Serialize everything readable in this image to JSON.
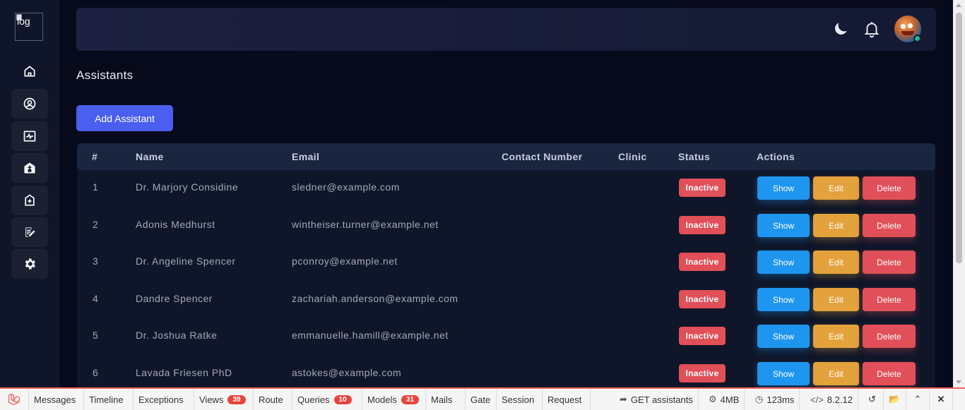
{
  "sidebar": {
    "logo_alt": "log",
    "items": [
      {
        "name": "home",
        "icon": "home-icon"
      },
      {
        "name": "profile",
        "icon": "user-circle-icon"
      },
      {
        "name": "activity",
        "icon": "activity-monitor-icon"
      },
      {
        "name": "clinics",
        "icon": "hospital-icon"
      },
      {
        "name": "medical",
        "icon": "medical-house-icon"
      },
      {
        "name": "records",
        "icon": "clipboard-edit-icon"
      },
      {
        "name": "settings",
        "icon": "gear-icon"
      }
    ]
  },
  "header": {
    "theme_icon": "moon-icon",
    "notification_icon": "bell-icon"
  },
  "page": {
    "title": "Assistants",
    "add_button": "Add Assistant"
  },
  "table": {
    "columns": [
      "#",
      "Name",
      "Email",
      "Contact Number",
      "Clinic",
      "Status",
      "Actions"
    ],
    "rows": [
      {
        "num": "1",
        "name": "Dr. Marjory Considine",
        "email": "sledner@example.com",
        "contact": "",
        "clinic": "",
        "status": "Inactive"
      },
      {
        "num": "2",
        "name": "Adonis Medhurst",
        "email": "wintheiser.turner@example.net",
        "contact": "",
        "clinic": "",
        "status": "Inactive"
      },
      {
        "num": "3",
        "name": "Dr. Angeline Spencer",
        "email": "pconroy@example.net",
        "contact": "",
        "clinic": "",
        "status": "Inactive"
      },
      {
        "num": "4",
        "name": "Dandre Spencer",
        "email": "zachariah.anderson@example.com",
        "contact": "",
        "clinic": "",
        "status": "Inactive"
      },
      {
        "num": "5",
        "name": "Dr. Joshua Ratke",
        "email": "emmanuelle.hamill@example.net",
        "contact": "",
        "clinic": "",
        "status": "Inactive"
      },
      {
        "num": "6",
        "name": "Lavada Friesen PhD",
        "email": "astokes@example.com",
        "contact": "",
        "clinic": "",
        "status": "Inactive"
      }
    ],
    "actions": {
      "show": "Show",
      "edit": "Edit",
      "delete": "Delete"
    }
  },
  "colors": {
    "accent": "#4a5ef0",
    "show": "#1e96f0",
    "edit": "#e3a23c",
    "delete": "#e14f58",
    "inactive": "#e14f58"
  },
  "debugbar": {
    "tabs": [
      {
        "label": "Messages"
      },
      {
        "label": "Timeline"
      },
      {
        "label": "Exceptions"
      },
      {
        "label": "Views",
        "count": "39"
      },
      {
        "label": "Route"
      },
      {
        "label": "Queries",
        "count": "10"
      },
      {
        "label": "Models",
        "count": "31"
      },
      {
        "label": "Mails"
      },
      {
        "label": "Gate"
      },
      {
        "label": "Session"
      },
      {
        "label": "Request"
      }
    ],
    "request": "GET assistants",
    "memory": "4MB",
    "time": "123ms",
    "php_version": "8.2.12"
  }
}
